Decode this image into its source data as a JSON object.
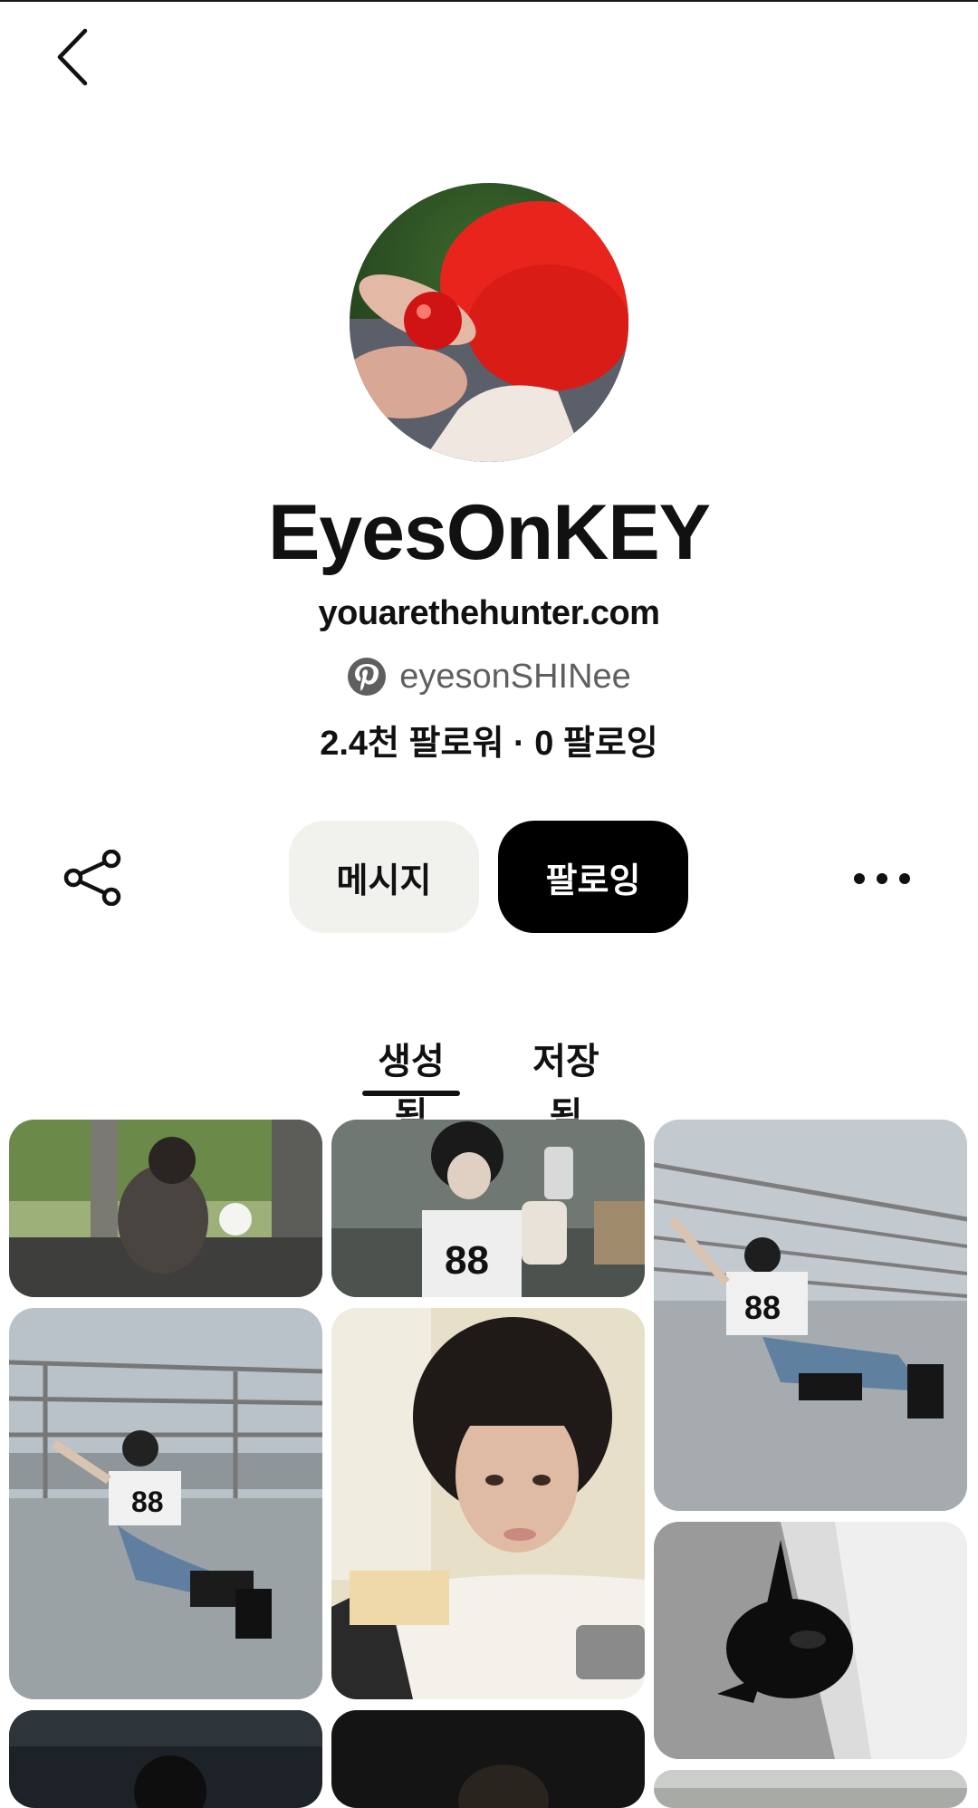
{
  "header": {
    "back_icon": "chevron-left-icon"
  },
  "profile": {
    "name": "EyesOnKEY",
    "website": "youarethehunter.com",
    "handle": "eyesonSHINee",
    "handle_icon": "pinterest-logo-icon",
    "stats": "2.4천 팔로워 · 0 팔로잉"
  },
  "actions": {
    "share_icon": "share-icon",
    "message_label": "메시지",
    "follow_label": "팔로잉",
    "more_icon": "more-horizontal-icon"
  },
  "tabs": [
    {
      "label": "생성됨",
      "active": true
    },
    {
      "label": "저장됨",
      "active": false
    }
  ],
  "colors": {
    "follow_button_bg": "#000000",
    "message_button_bg": "#f1f1ee",
    "handle_text": "#5f5f5f"
  }
}
